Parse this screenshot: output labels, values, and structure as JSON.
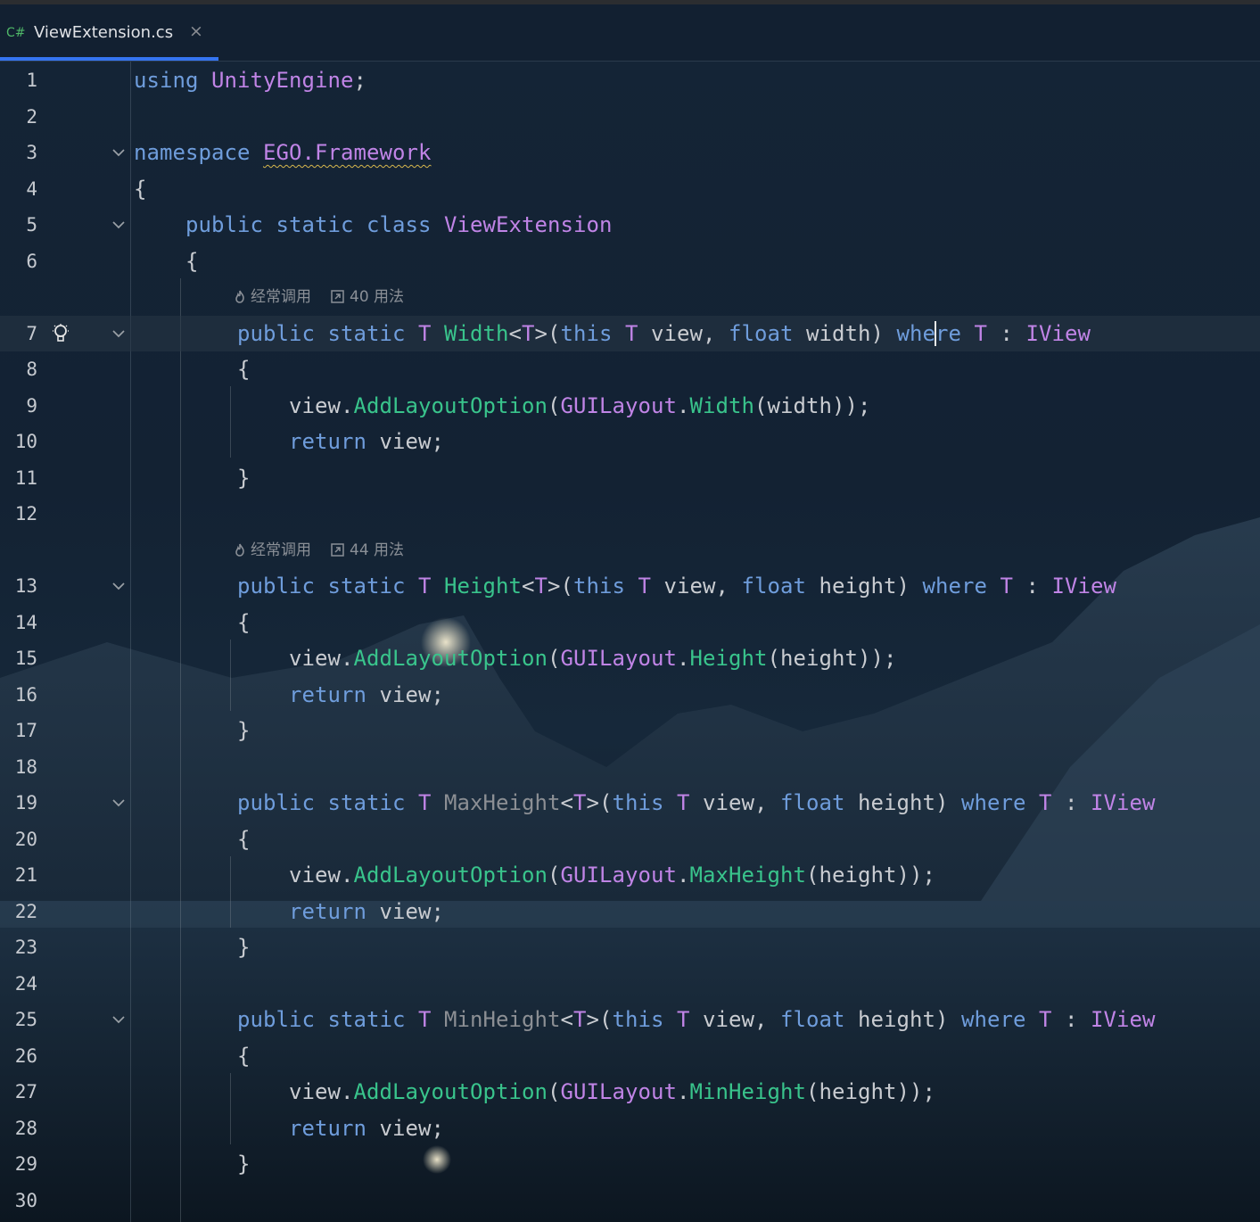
{
  "tab": {
    "lang": "C#",
    "title": "ViewExtension.cs",
    "close": "×",
    "accent": "#3574f0"
  },
  "colors": {
    "keyword": "#6f9ddc",
    "type": "#c084e6",
    "method": "#39c48c",
    "plain": "#c9ccd1"
  },
  "hints": [
    {
      "frequent": "经常调用",
      "usages": "40 用法"
    },
    {
      "frequent": "经常调用",
      "usages": "44 用法"
    }
  ],
  "lines": [
    {
      "n": "1",
      "tokens": [
        [
          "kw",
          "using"
        ],
        [
          "pl",
          " "
        ],
        [
          "ty",
          "UnityEngine"
        ],
        [
          "pl",
          ";"
        ]
      ]
    },
    {
      "n": "2",
      "tokens": []
    },
    {
      "n": "3",
      "fold": true,
      "tokens": [
        [
          "kw",
          "namespace"
        ],
        [
          "pl",
          " "
        ],
        [
          "ty squiggle",
          "EGO.Framework"
        ]
      ]
    },
    {
      "n": "4",
      "tokens": [
        [
          "pl",
          "{"
        ]
      ]
    },
    {
      "n": "5",
      "fold": true,
      "tokens": [
        [
          "pl",
          "    "
        ],
        [
          "kw",
          "public static class"
        ],
        [
          "pl",
          " "
        ],
        [
          "ty",
          "ViewExtension"
        ]
      ]
    },
    {
      "n": "6",
      "tokens": [
        [
          "pl",
          "    {"
        ]
      ]
    },
    {
      "hint": 0
    },
    {
      "n": "7",
      "fold": true,
      "bulb": true,
      "current": true,
      "tokens": [
        [
          "pl",
          "        "
        ],
        [
          "kw",
          "public static"
        ],
        [
          "pl",
          " "
        ],
        [
          "ty",
          "T"
        ],
        [
          "pl",
          " "
        ],
        [
          "fn",
          "Width"
        ],
        [
          "pl",
          "<"
        ],
        [
          "ty",
          "T"
        ],
        [
          "pl",
          ">("
        ],
        [
          "kw",
          "this"
        ],
        [
          "pl",
          " "
        ],
        [
          "ty",
          "T"
        ],
        [
          "pl",
          " view, "
        ],
        [
          "kw",
          "float"
        ],
        [
          "pl",
          " width) "
        ],
        [
          "kw",
          "whe"
        ],
        [
          "caret",
          ""
        ],
        [
          "kw",
          "re"
        ],
        [
          "pl",
          " "
        ],
        [
          "ty",
          "T"
        ],
        [
          "pl",
          " : "
        ],
        [
          "ty",
          "IView"
        ]
      ]
    },
    {
      "n": "8",
      "tokens": [
        [
          "pl",
          "        {"
        ]
      ]
    },
    {
      "n": "9",
      "tokens": [
        [
          "pl",
          "            view."
        ],
        [
          "fn",
          "AddLayoutOption"
        ],
        [
          "pl",
          "("
        ],
        [
          "ty",
          "GUILayout"
        ],
        [
          "pl",
          "."
        ],
        [
          "fn",
          "Width"
        ],
        [
          "pl",
          "(width));"
        ]
      ]
    },
    {
      "n": "10",
      "tokens": [
        [
          "pl",
          "            "
        ],
        [
          "kw",
          "return"
        ],
        [
          "pl",
          " view;"
        ]
      ]
    },
    {
      "n": "11",
      "tokens": [
        [
          "pl",
          "        }"
        ]
      ]
    },
    {
      "n": "12",
      "tokens": []
    },
    {
      "hint": 1
    },
    {
      "n": "13",
      "fold": true,
      "tokens": [
        [
          "pl",
          "        "
        ],
        [
          "kw",
          "public static"
        ],
        [
          "pl",
          " "
        ],
        [
          "ty",
          "T"
        ],
        [
          "pl",
          " "
        ],
        [
          "fn",
          "Height"
        ],
        [
          "pl",
          "<"
        ],
        [
          "ty",
          "T"
        ],
        [
          "pl",
          ">("
        ],
        [
          "kw",
          "this"
        ],
        [
          "pl",
          " "
        ],
        [
          "ty",
          "T"
        ],
        [
          "pl",
          " view, "
        ],
        [
          "kw",
          "float"
        ],
        [
          "pl",
          " height) "
        ],
        [
          "kw",
          "where"
        ],
        [
          "pl",
          " "
        ],
        [
          "ty",
          "T"
        ],
        [
          "pl",
          " : "
        ],
        [
          "ty",
          "IView"
        ]
      ]
    },
    {
      "n": "14",
      "tokens": [
        [
          "pl",
          "        {"
        ]
      ]
    },
    {
      "n": "15",
      "tokens": [
        [
          "pl",
          "            view."
        ],
        [
          "fn",
          "AddLayoutOption"
        ],
        [
          "pl",
          "("
        ],
        [
          "ty",
          "GUILayout"
        ],
        [
          "pl",
          "."
        ],
        [
          "fn",
          "Height"
        ],
        [
          "pl",
          "(height));"
        ]
      ]
    },
    {
      "n": "16",
      "tokens": [
        [
          "pl",
          "            "
        ],
        [
          "kw",
          "return"
        ],
        [
          "pl",
          " view;"
        ]
      ]
    },
    {
      "n": "17",
      "tokens": [
        [
          "pl",
          "        }"
        ]
      ]
    },
    {
      "n": "18",
      "tokens": []
    },
    {
      "n": "19",
      "fold": true,
      "tokens": [
        [
          "pl",
          "        "
        ],
        [
          "kw",
          "public static"
        ],
        [
          "pl",
          " "
        ],
        [
          "ty",
          "T"
        ],
        [
          "pl",
          " "
        ],
        [
          "dim",
          "MaxHeight"
        ],
        [
          "pl",
          "<"
        ],
        [
          "ty",
          "T"
        ],
        [
          "pl",
          ">("
        ],
        [
          "kw",
          "this"
        ],
        [
          "pl",
          " "
        ],
        [
          "ty",
          "T"
        ],
        [
          "pl",
          " view, "
        ],
        [
          "kw",
          "float"
        ],
        [
          "pl",
          " height) "
        ],
        [
          "kw",
          "where"
        ],
        [
          "pl",
          " "
        ],
        [
          "ty",
          "T"
        ],
        [
          "pl",
          " : "
        ],
        [
          "ty",
          "IView"
        ]
      ]
    },
    {
      "n": "20",
      "tokens": [
        [
          "pl",
          "        {"
        ]
      ]
    },
    {
      "n": "21",
      "tokens": [
        [
          "pl",
          "            view."
        ],
        [
          "fn",
          "AddLayoutOption"
        ],
        [
          "pl",
          "("
        ],
        [
          "ty",
          "GUILayout"
        ],
        [
          "pl",
          "."
        ],
        [
          "fn",
          "MaxHeight"
        ],
        [
          "pl",
          "(height));"
        ]
      ]
    },
    {
      "n": "22",
      "tokens": [
        [
          "pl",
          "            "
        ],
        [
          "kw",
          "return"
        ],
        [
          "pl",
          " view;"
        ]
      ]
    },
    {
      "n": "23",
      "tokens": [
        [
          "pl",
          "        }"
        ]
      ]
    },
    {
      "n": "24",
      "tokens": []
    },
    {
      "n": "25",
      "fold": true,
      "tokens": [
        [
          "pl",
          "        "
        ],
        [
          "kw",
          "public static"
        ],
        [
          "pl",
          " "
        ],
        [
          "ty",
          "T"
        ],
        [
          "pl",
          " "
        ],
        [
          "dim",
          "MinHeight"
        ],
        [
          "pl",
          "<"
        ],
        [
          "ty",
          "T"
        ],
        [
          "pl",
          ">("
        ],
        [
          "kw",
          "this"
        ],
        [
          "pl",
          " "
        ],
        [
          "ty",
          "T"
        ],
        [
          "pl",
          " view, "
        ],
        [
          "kw",
          "float"
        ],
        [
          "pl",
          " height) "
        ],
        [
          "kw",
          "where"
        ],
        [
          "pl",
          " "
        ],
        [
          "ty",
          "T"
        ],
        [
          "pl",
          " : "
        ],
        [
          "ty",
          "IView"
        ]
      ]
    },
    {
      "n": "26",
      "tokens": [
        [
          "pl",
          "        {"
        ]
      ]
    },
    {
      "n": "27",
      "tokens": [
        [
          "pl",
          "            view."
        ],
        [
          "fn",
          "AddLayoutOption"
        ],
        [
          "pl",
          "("
        ],
        [
          "ty",
          "GUILayout"
        ],
        [
          "pl",
          "."
        ],
        [
          "fn",
          "MinHeight"
        ],
        [
          "pl",
          "(height));"
        ]
      ]
    },
    {
      "n": "28",
      "tokens": [
        [
          "pl",
          "            "
        ],
        [
          "kw",
          "return"
        ],
        [
          "pl",
          " view;"
        ]
      ]
    },
    {
      "n": "29",
      "tokens": [
        [
          "pl",
          "        }"
        ]
      ]
    },
    {
      "n": "30",
      "tokens": []
    }
  ]
}
